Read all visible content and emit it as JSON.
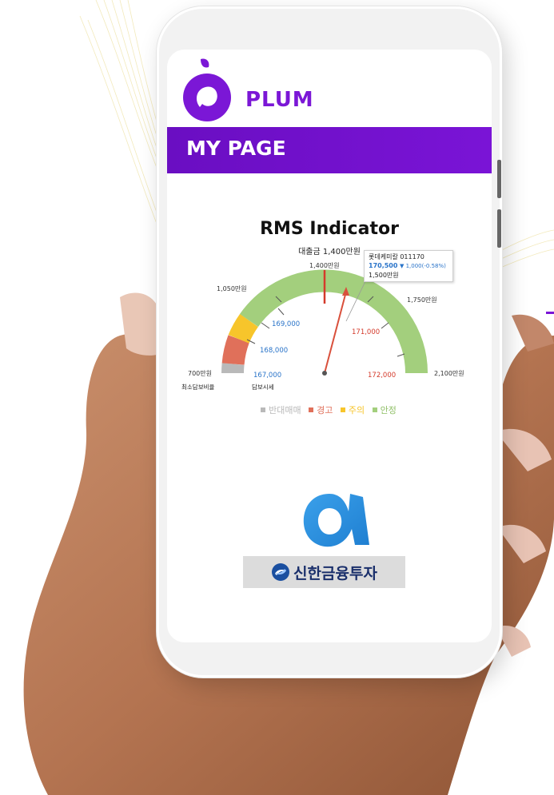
{
  "brand": {
    "name": "PLUM",
    "color": "#7b17d6",
    "icon": "plum-logo-icon"
  },
  "header": {
    "title": "MY PAGE"
  },
  "rms": {
    "title": "RMS Indicator",
    "loan_label": "대출금 1,400만원",
    "tooltip": {
      "stock": "롯데케미칼 011170",
      "price": "170,500",
      "change": "▼ 1,000(-0.58%)",
      "amount": "1,500만원"
    },
    "scale_labels": {
      "min": "700만원",
      "p1050": "1,050만원",
      "p1400": "1,400만원",
      "p1750": "1,750만원",
      "max": "2,100만원"
    },
    "price_labels": {
      "p167": "167,000",
      "p168": "168,000",
      "p169": "169,000",
      "p171": "171,000",
      "p172": "172,000"
    },
    "bottom_left": "최소담보비율",
    "bottom_mid": "담보시세",
    "legend": [
      {
        "label": "반대매매",
        "color": "#b9b9b9"
      },
      {
        "label": "경고",
        "color": "#e0705a"
      },
      {
        "label": "주의",
        "color": "#f7c52b"
      },
      {
        "label": "안정",
        "color": "#a3cf7d"
      }
    ]
  },
  "partner": {
    "name": "신한금융투자",
    "logo_icon": "alpha-logo-icon",
    "emblem_icon": "shinhan-emblem-icon"
  }
}
